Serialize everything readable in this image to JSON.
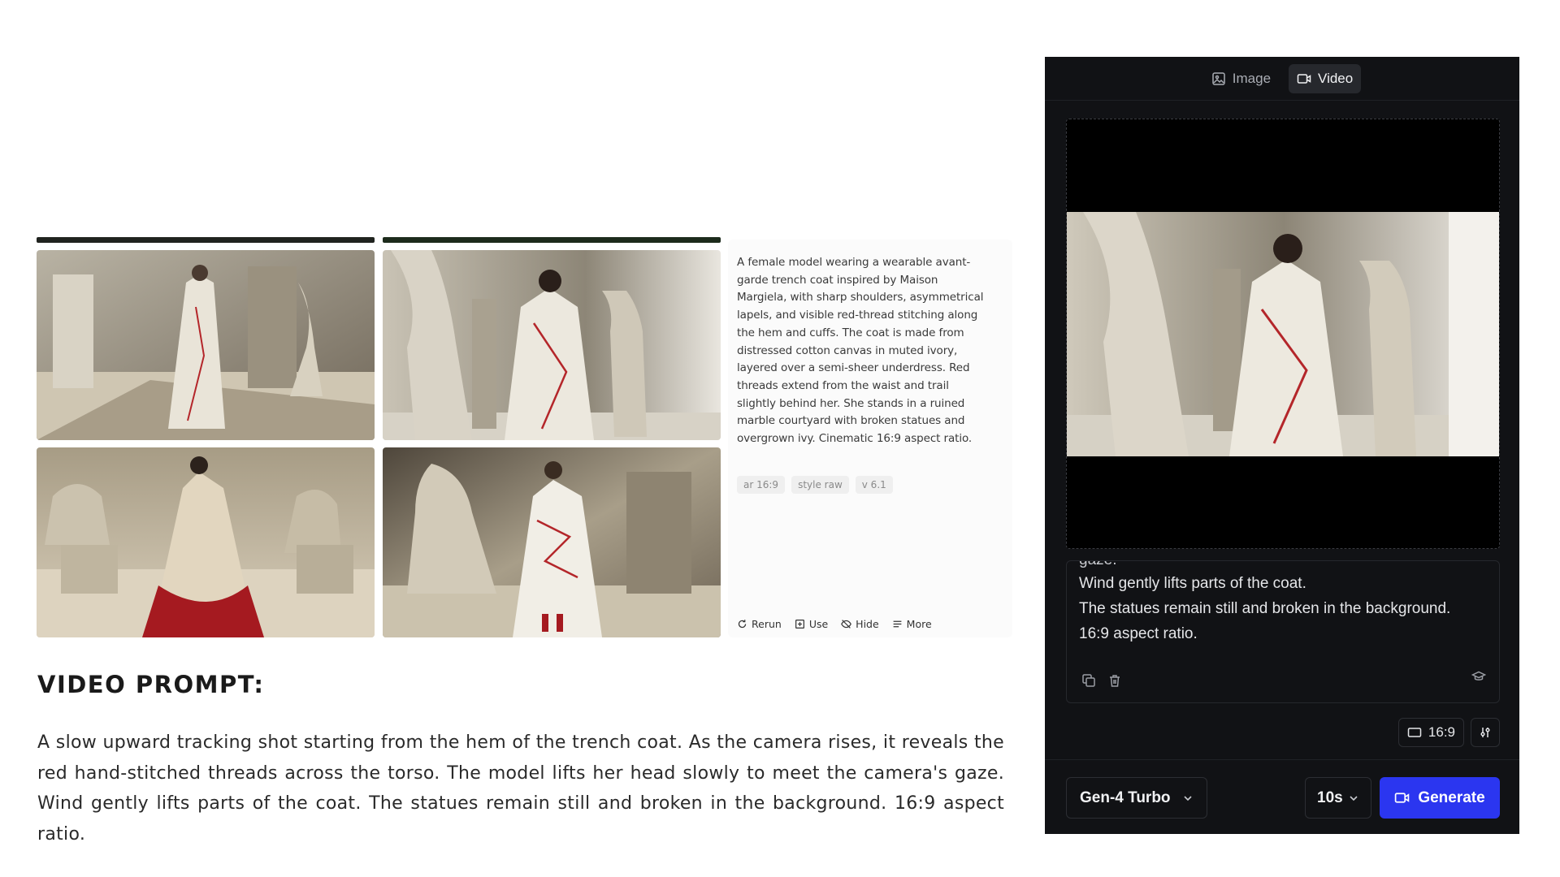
{
  "gallery": {
    "prompt_text": "A female model wearing a wearable avant-garde trench coat inspired by Maison Margiela, with sharp shoulders, asymmetrical lapels, and visible red-thread stitching along the hem and cuffs. The coat is made from distressed cotton canvas in muted ivory, layered over a semi-sheer underdress. Red threads extend from the waist and trail slightly behind her. She stands in a ruined marble courtyard with broken statues and overgrown ivy. Cinematic 16:9 aspect ratio.",
    "tags": [
      "ar 16:9",
      "style raw",
      "v 6.1"
    ],
    "actions": [
      {
        "label": "Rerun",
        "icon": "rerun-icon"
      },
      {
        "label": "Use",
        "icon": "use-icon"
      },
      {
        "label": "Hide",
        "icon": "hide-icon"
      },
      {
        "label": "More",
        "icon": "more-icon"
      }
    ]
  },
  "video_prompt": {
    "heading": "VIDEO PROMPT:",
    "body": "A slow upward tracking shot starting from the hem of the trench coat. As the camera rises, it reveals the red hand-stitched threads across the torso. The model lifts her head slowly to meet the camera's gaze. Wind gently lifts parts of the coat. The statues remain still and broken in the background. 16:9 aspect ratio."
  },
  "panel": {
    "tabs": [
      {
        "label": "Image",
        "icon": "image-icon",
        "active": false
      },
      {
        "label": "Video",
        "icon": "video-icon",
        "active": true
      }
    ],
    "textbox_cut": "gaze.",
    "textbox_lines": [
      "Wind gently lifts parts of the coat.",
      "The statues remain still and broken in the background.",
      "16:9 aspect ratio."
    ],
    "ratio": "16:9",
    "model": "Gen-4 Turbo",
    "duration": "10s",
    "generate_label": "Generate"
  },
  "colors": {
    "panel_bg": "#111215",
    "accent": "#2b36f0"
  }
}
